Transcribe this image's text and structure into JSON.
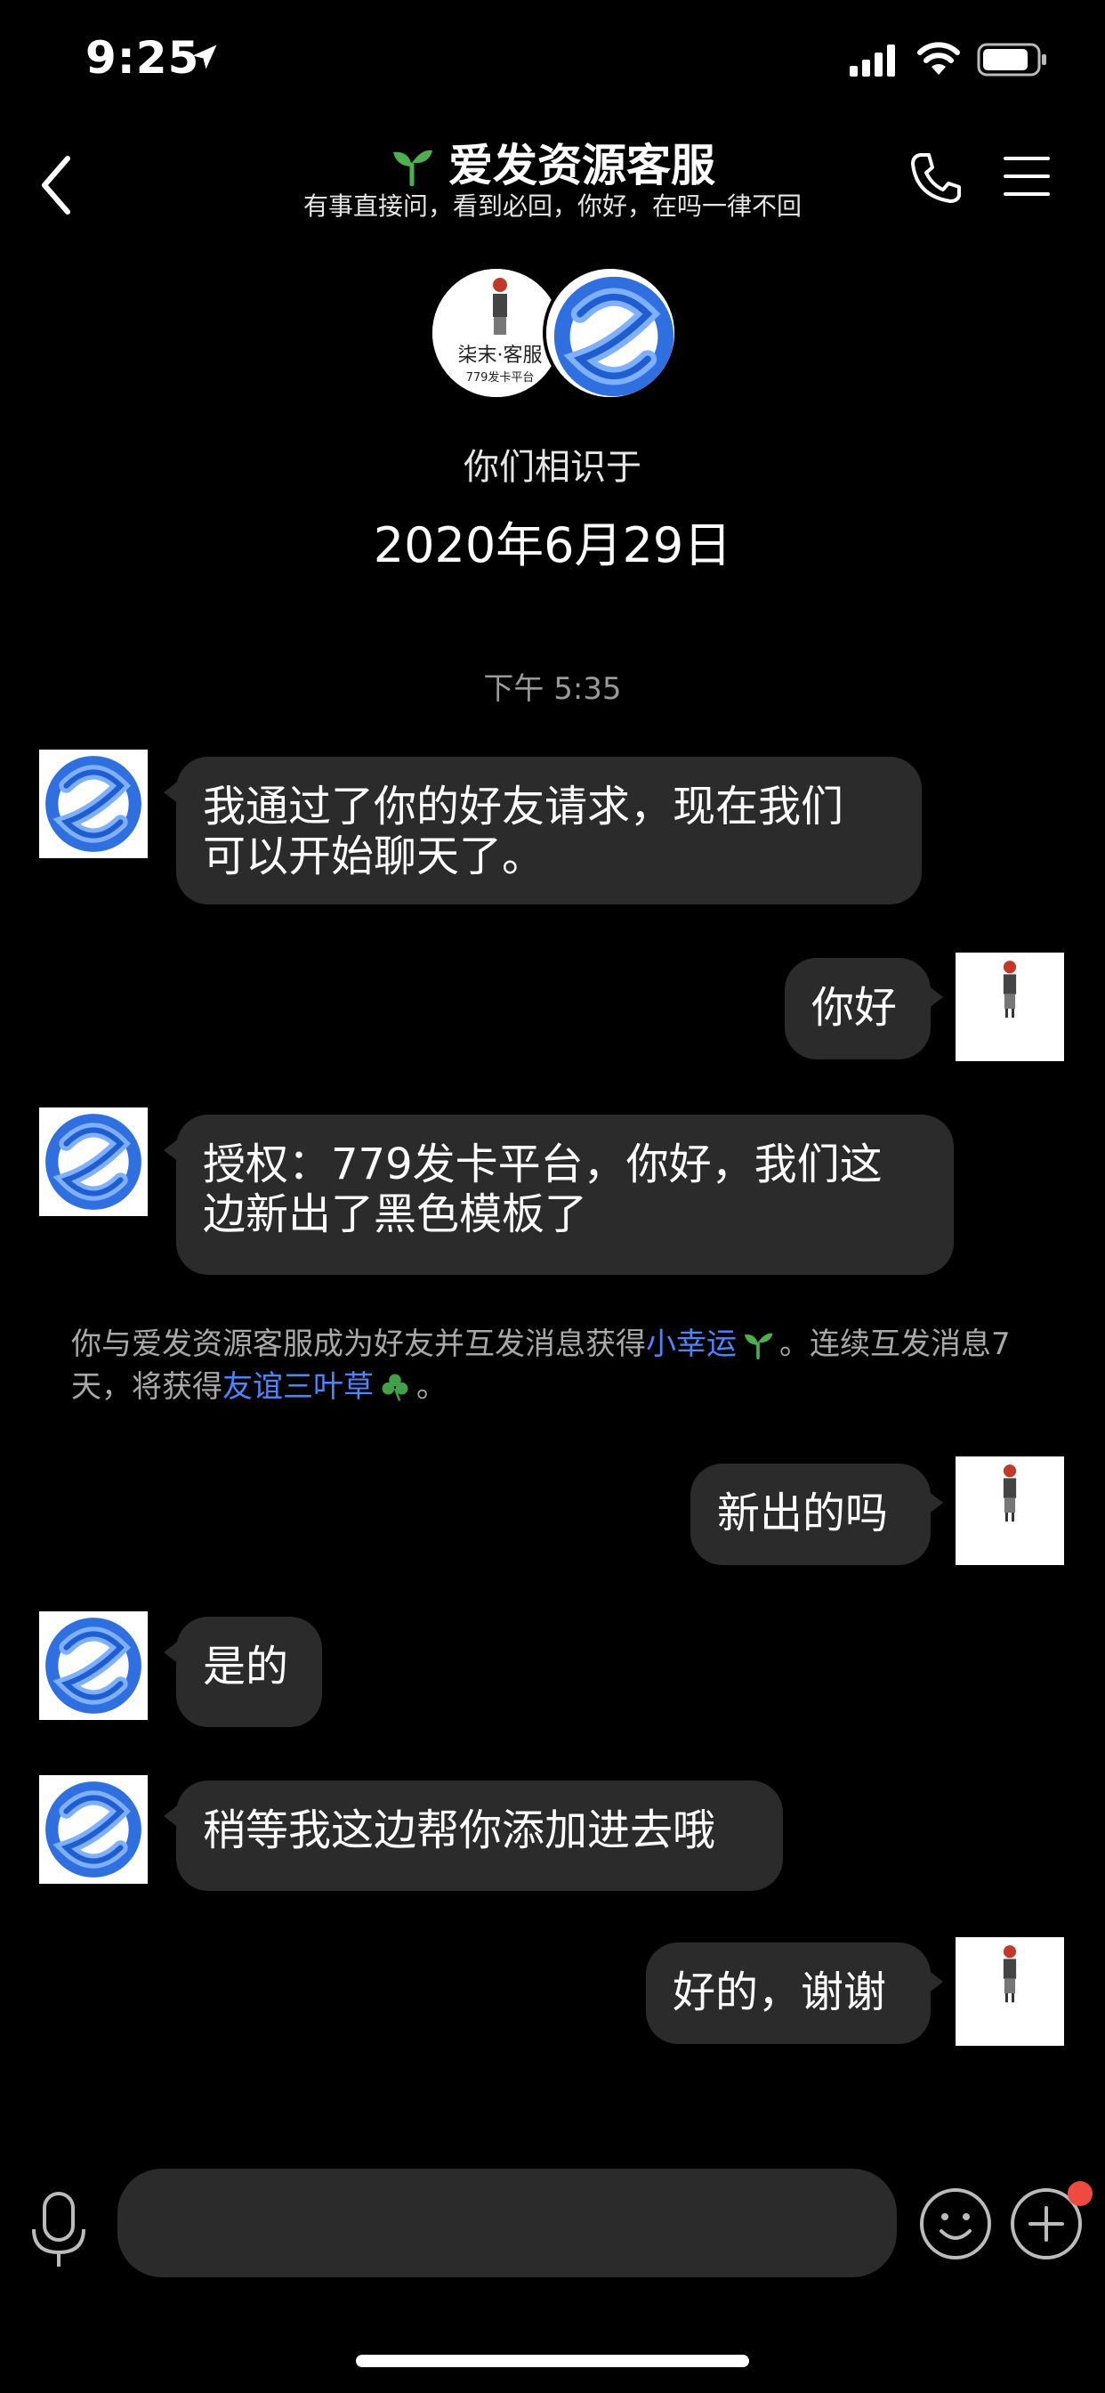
{
  "status_bar": {
    "time": "9:25",
    "icons": [
      "location-arrow-icon",
      "cellular-signal-icon",
      "wifi-icon",
      "battery-icon"
    ]
  },
  "header": {
    "title": "爱发资源客服",
    "subtitle": "有事直接问，看到必回，你好，在吗一律不回",
    "icons": [
      "back-chevron-icon",
      "sprout-icon",
      "phone-icon",
      "menu-icon"
    ]
  },
  "intro": {
    "avatar1_text": "柒末·客服",
    "avatar1_sub": "779发卡平台",
    "met_label": "你们相识于",
    "met_date": "2020年6月29日"
  },
  "timestamp": "下午 5:35",
  "messages": [
    {
      "side": "left",
      "text_line1": "我通过了你的好友请求，现在我们",
      "text_line2": "可以开始聊天了。"
    },
    {
      "side": "right",
      "text": "你好"
    },
    {
      "side": "left",
      "text_line1": "授权：779发卡平台，你好，我们这",
      "text_line2": "边新出了黑色模板了"
    },
    {
      "side": "right",
      "text": "新出的吗"
    },
    {
      "side": "left",
      "text": "是的"
    },
    {
      "side": "left",
      "text": "稍等我这边帮你添加进去哦"
    },
    {
      "side": "right",
      "text": "好的，谢谢"
    }
  ],
  "system_note": {
    "part1": "你与爱发资源客服成为好友并互发消息获得",
    "link1": "小幸运",
    "part2": "。连续互发消息7天，将获得",
    "link2": "友谊三叶草",
    "part3": "。"
  },
  "input_bar": {
    "placeholder": "",
    "icons": [
      "microphone-icon",
      "emoji-icon",
      "plus-icon"
    ]
  },
  "colors": {
    "background": "#000000",
    "bubble": "#2b2b2b",
    "link": "#4f84ff",
    "badge": "#ef4a3f",
    "sprout": "#4caf50"
  }
}
